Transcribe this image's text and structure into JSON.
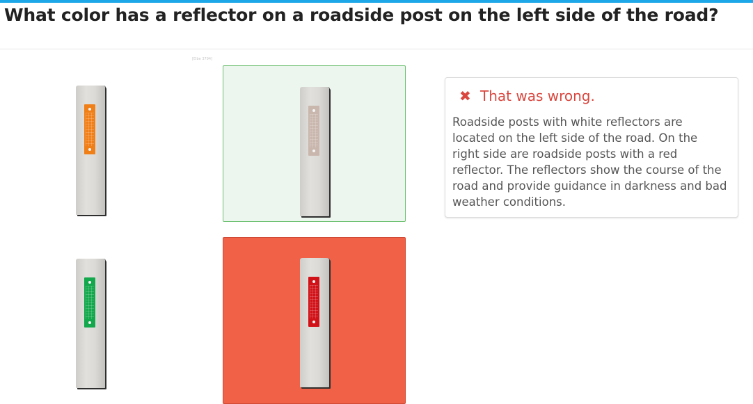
{
  "question": "What color has a reflector on a roadside post on the left side of the road?",
  "image_credit": "[Elbe 3794]",
  "options": [
    {
      "reflector_color": "orange",
      "reflector_hex": "#f07f18",
      "state": "unselected"
    },
    {
      "reflector_color": "white",
      "reflector_hex": "#c9b7ad",
      "state": "correct"
    },
    {
      "reflector_color": "green",
      "reflector_hex": "#13a84c",
      "state": "unselected"
    },
    {
      "reflector_color": "red",
      "reflector_hex": "#d11218",
      "state": "wrong"
    }
  ],
  "feedback": {
    "icon": "x-icon",
    "title": "That was wrong.",
    "text": "Roadside posts with white reflectors are located on the left side of the road. On the right side are roadside posts with a red reflector. The reflectors show the course of the road and provide guidance in darkness and bad weather conditions."
  },
  "colors": {
    "accent_bar": "#1ea7e8",
    "correct_bg": "#edf6ee",
    "correct_border": "#6cbf6f",
    "wrong_bg": "#f16148",
    "feedback_title": "#d9473f"
  }
}
